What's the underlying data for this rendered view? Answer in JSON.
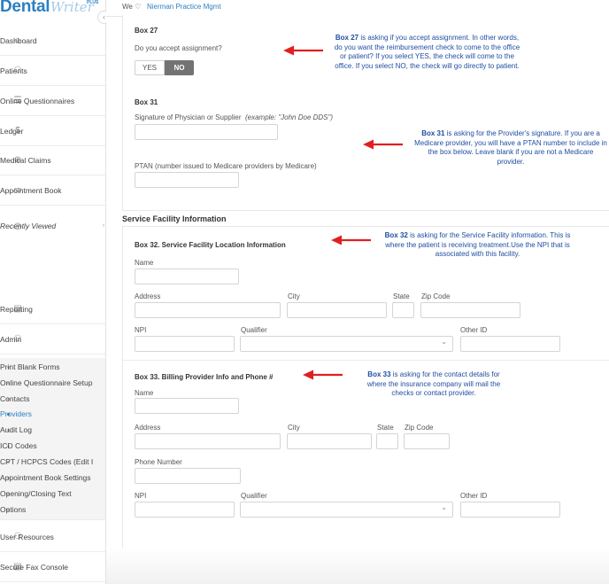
{
  "brand": {
    "name_bold": "Dental",
    "name_script": "Writer",
    "plus": "PLUS"
  },
  "topbar": {
    "we_label": "We ♡",
    "practice_name": "Nierman Practice Mgmt"
  },
  "sidebar": {
    "collapse_glyph": "‹",
    "items": [
      {
        "label": "Dashboard",
        "icon": "⌂"
      },
      {
        "label": "Patients",
        "icon": "⚇"
      },
      {
        "label": "Online Questionnaires",
        "icon": "☰"
      },
      {
        "label": "Ledger",
        "icon": "$"
      },
      {
        "label": "Medical Claims",
        "icon": "⊕"
      },
      {
        "label": "Appointment Book",
        "icon": "▭"
      },
      {
        "label": "Recently Viewed",
        "icon": "◷",
        "arrow": "›"
      },
      {
        "label": "Reporting",
        "icon": "▤"
      },
      {
        "label": "Admin",
        "icon": "⚇"
      }
    ],
    "submenu": [
      "Print Blank Forms",
      "Online Questionnaire Setup",
      "Contacts",
      "Providers",
      "Audit Log",
      "ICD Codes",
      "CPT / HCPCS Codes (Edit I",
      "Appointment Book Settings",
      "Opening/Closing Text",
      "Options"
    ],
    "active_submenu": "Providers",
    "bottom_items": [
      {
        "label": "User Resources",
        "icon": "⚇"
      },
      {
        "label": "Secure Fax Console",
        "icon": "▤"
      }
    ]
  },
  "box27": {
    "title": "Box 27",
    "question": "Do you accept assignment?",
    "yes_label": "YES",
    "no_label": "NO",
    "selected": "NO"
  },
  "box31": {
    "title": "Box 31",
    "signature_label": "Signature of Physician or Supplier",
    "signature_example": "(example: \"John Doe DDS\")",
    "ptan_label": "PTAN (number issued to Medicare providers by Medicare)"
  },
  "service_facility": {
    "section_title": "Service Facility Information",
    "box_title": "Box 32. Service Facility Location Information",
    "name_label": "Name",
    "address_label": "Address",
    "city_label": "City",
    "state_label": "State",
    "zip_label": "Zip Code",
    "npi_label": "NPI",
    "qualifier_label": "Qualifier",
    "other_id_label": "Other ID"
  },
  "billing_provider": {
    "box_title": "Box 33. Billing Provider Info and Phone #",
    "name_label": "Name",
    "address_label": "Address",
    "city_label": "City",
    "state_label": "State",
    "zip_label": "Zip Code",
    "phone_label": "Phone Number",
    "npi_label": "NPI",
    "qualifier_label": "Qualifier",
    "other_id_label": "Other ID"
  },
  "notes": {
    "box27": {
      "bold": "Box 27",
      "text": " is asking if you accept assignment. In other words, do you want the reimbursement check to come to the office or patient? If you select YES, the check will come to the office. If you select NO, the check will go directly to patient."
    },
    "box31": {
      "bold": "Box 31",
      "text": " is asking for the Provider's signature. If you are a Medicare provider, you will have a PTAN number to include in the box below. Leave blank if you are not a Medicare provider."
    },
    "box32": {
      "bold": "Box 32",
      "text": " is asking for the Service Facility information. This is where the patient is receiving treatment.Use the NPI that is associated with this facility."
    },
    "box33": {
      "bold": "Box 33",
      "text": " is asking for the contact details for where the insurance company will mail the checks or contact provider."
    }
  },
  "colors": {
    "accent": "#2d7fc1",
    "note_text": "#1f4ea1",
    "arrow": "#e02020",
    "toggle_selected": "#737373"
  }
}
